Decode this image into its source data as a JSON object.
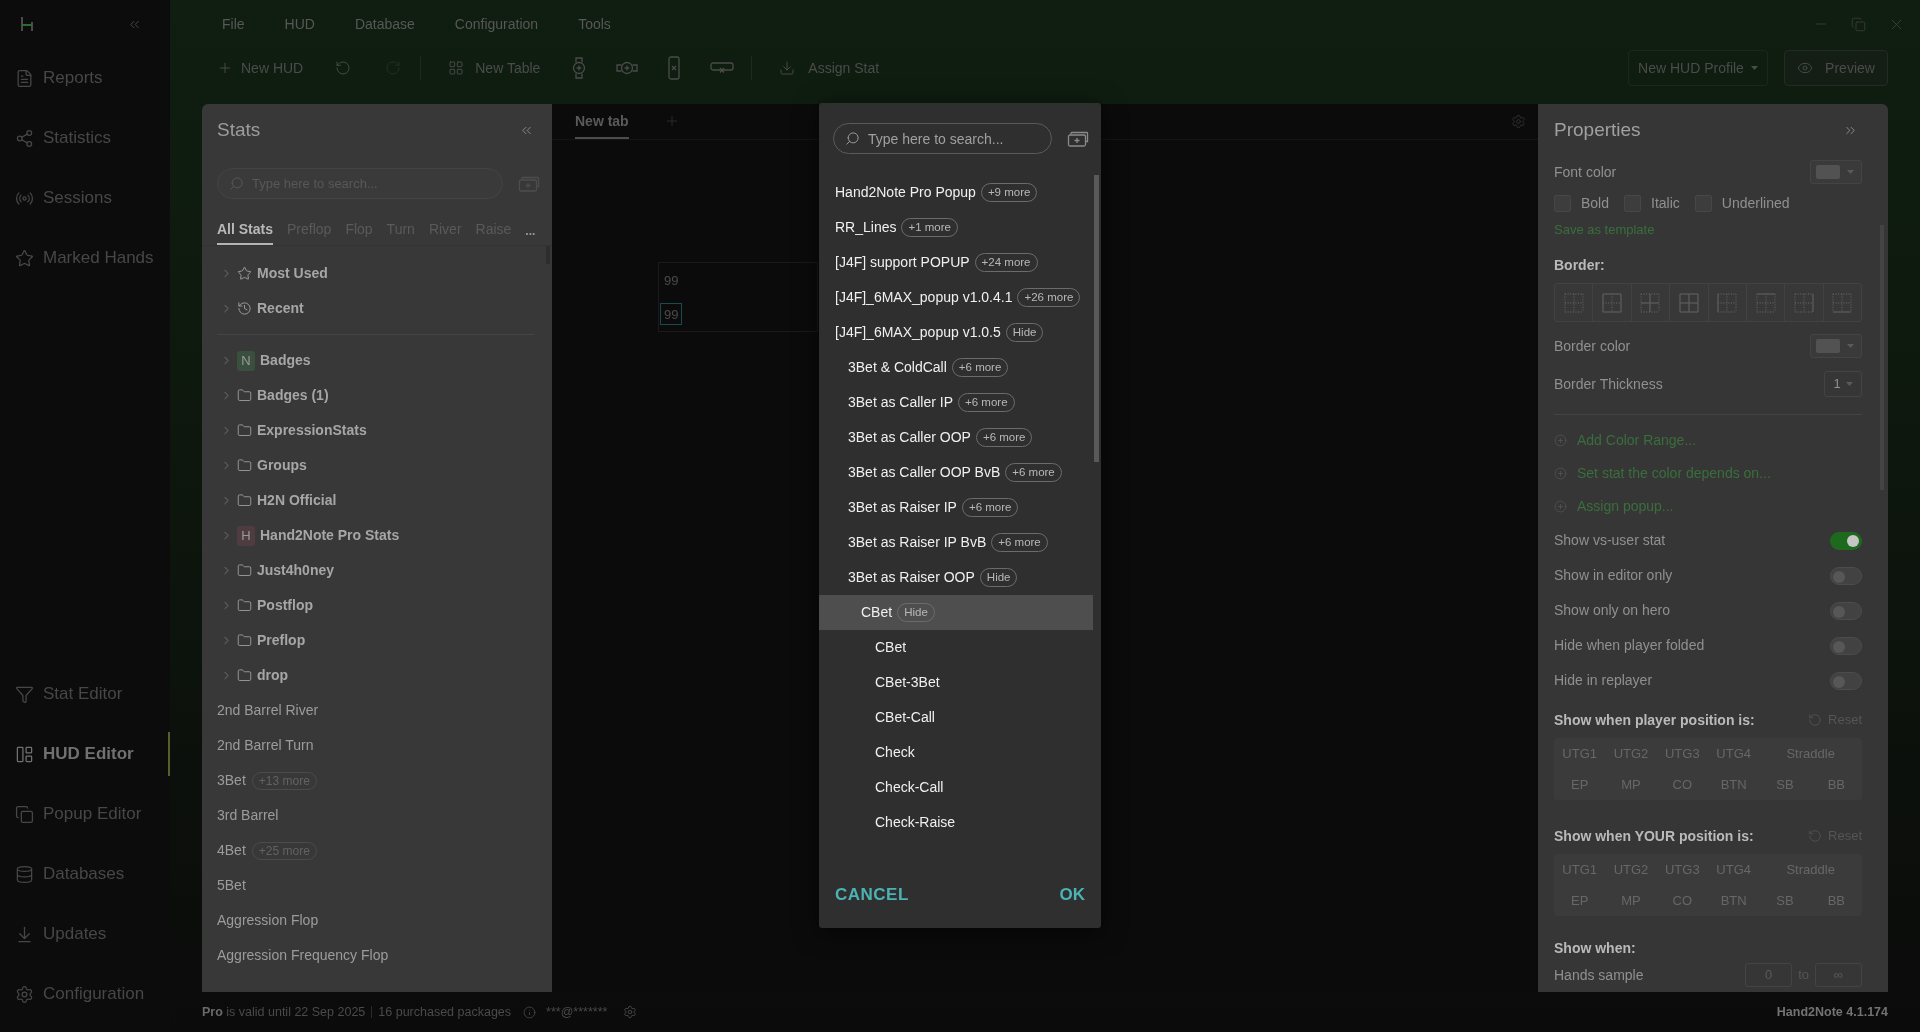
{
  "nav": {
    "top": [
      {
        "label": "Reports",
        "selected": false
      },
      {
        "label": "Statistics",
        "selected": false
      },
      {
        "label": "Sessions",
        "selected": false
      },
      {
        "label": "Marked Hands",
        "selected": false
      }
    ],
    "bottom": [
      {
        "label": "Stat Editor",
        "selected": false
      },
      {
        "label": "HUD Editor",
        "selected": true
      },
      {
        "label": "Popup Editor",
        "selected": false
      },
      {
        "label": "Databases",
        "selected": false
      },
      {
        "label": "Updates",
        "selected": false
      },
      {
        "label": "Configuration",
        "selected": false
      }
    ]
  },
  "menu": [
    "File",
    "HUD",
    "Database",
    "Configuration",
    "Tools"
  ],
  "toolbar": {
    "new_hud": "New HUD",
    "undo": {
      "disabled": false
    },
    "redo": {
      "disabled": true
    },
    "new_table": "New Table",
    "assign_stat": "Assign Stat",
    "profile": "New HUD Profile",
    "preview": "Preview"
  },
  "stats_panel": {
    "title": "Stats",
    "search": {
      "placeholder": "Type here to search..."
    },
    "tabs": [
      {
        "label": "All Stats",
        "selected": true
      },
      {
        "label": "Preflop",
        "selected": false
      },
      {
        "label": "Flop",
        "selected": false
      },
      {
        "label": "Turn",
        "selected": false
      },
      {
        "label": "River",
        "selected": false
      },
      {
        "label": "Raise",
        "selected": false
      }
    ],
    "tabs_more": "...",
    "shortcuts": [
      {
        "label": "Most Used",
        "kind": "starred",
        "expanded": false
      },
      {
        "label": "Recent",
        "kind": "recent",
        "expanded": false
      }
    ],
    "folders": [
      {
        "label": "Badges",
        "kind": "tagged",
        "letter": "N",
        "color": "#3b4f3f",
        "expanded": false
      },
      {
        "label": "Badges (1)",
        "kind": "folder",
        "expanded": false
      },
      {
        "label": "ExpressionStats",
        "kind": "folder",
        "expanded": false
      },
      {
        "label": "Groups",
        "kind": "folder",
        "expanded": false
      },
      {
        "label": "H2N Official",
        "kind": "folder",
        "expanded": false
      },
      {
        "label": "Hand2Note Pro Stats",
        "kind": "tagged",
        "letter": "H",
        "color": "#4f3c40",
        "expanded": false
      },
      {
        "label": "Just4h0ney",
        "kind": "folder",
        "expanded": false
      },
      {
        "label": "Postflop",
        "kind": "folder",
        "expanded": false
      },
      {
        "label": "Preflop",
        "kind": "folder",
        "expanded": false
      },
      {
        "label": "drop",
        "kind": "folder",
        "expanded": false
      }
    ],
    "stats": [
      {
        "label": "2nd Barrel River"
      },
      {
        "label": "2nd Barrel Turn"
      },
      {
        "label": "3Bet",
        "more": "+13 more"
      },
      {
        "label": "3rd Barrel"
      },
      {
        "label": "4Bet",
        "more": "+25 more"
      },
      {
        "label": "5Bet"
      },
      {
        "label": "Aggression Flop"
      },
      {
        "label": "Aggression Frequency Flop"
      }
    ]
  },
  "editor": {
    "tabs": [
      {
        "label": "New tab",
        "selected": true
      }
    ],
    "hud_cells": [
      {
        "text": "99",
        "selected": false
      },
      {
        "text": "99",
        "selected": true
      }
    ]
  },
  "popup_dialog": {
    "search": {
      "placeholder": "Type here to search..."
    },
    "items": [
      {
        "label": "Hand2Note Pro Popup",
        "tag": "+9 more",
        "selected": false
      },
      {
        "label": "RR_Lines",
        "tag": "+1 more",
        "selected": false
      },
      {
        "label": "[J4F] support POPUP",
        "tag": "+24 more",
        "selected": false
      },
      {
        "label": "[J4F]_6MAX_popup v1.0.4.1",
        "tag": "+26 more",
        "selected": false
      },
      {
        "label": "[J4F]_6MAX_popup v1.0.5",
        "tag": "Hide",
        "selected": false,
        "children": [
          {
            "label": "3Bet & ColdCall",
            "tag": "+6 more",
            "selected": false
          },
          {
            "label": "3Bet as Caller IP",
            "tag": "+6 more",
            "selected": false
          },
          {
            "label": "3Bet as Caller OOP",
            "tag": "+6 more",
            "selected": false
          },
          {
            "label": "3Bet as Caller OOP BvB",
            "tag": "+6 more",
            "selected": false
          },
          {
            "label": "3Bet as Raiser IP",
            "tag": "+6 more",
            "selected": false
          },
          {
            "label": "3Bet as Raiser IP BvB",
            "tag": "+6 more",
            "selected": false
          },
          {
            "label": "3Bet as Raiser OOP",
            "tag": "Hide",
            "selected": false,
            "children": [
              {
                "label": "CBet",
                "tag": "Hide",
                "selected": true,
                "children": [
                  {
                    "label": "CBet",
                    "selected": false
                  },
                  {
                    "label": "CBet-3Bet",
                    "selected": false
                  },
                  {
                    "label": "CBet-Call",
                    "selected": false
                  },
                  {
                    "label": "Check",
                    "selected": false
                  },
                  {
                    "label": "Check-Call",
                    "selected": false
                  },
                  {
                    "label": "Check-Raise",
                    "selected": false
                  }
                ]
              }
            ]
          }
        ]
      }
    ],
    "cancel": "CANCEL",
    "ok": "OK"
  },
  "properties": {
    "title": "Properties",
    "font_color": "Font color",
    "styles": [
      {
        "label": "Bold",
        "checked": false
      },
      {
        "label": "Italic",
        "checked": false
      },
      {
        "label": "Underlined",
        "checked": false
      }
    ],
    "save_template": "Save as template",
    "border": "Border:",
    "border_color": "Border color",
    "border_thickness": {
      "label": "Border Thickness",
      "value": "1"
    },
    "actions": [
      "Add Color Range...",
      "Set stat the color depends on...",
      "Assign popup..."
    ],
    "toggles": [
      {
        "label": "Show vs-user stat",
        "on": true
      },
      {
        "label": "Show in editor only",
        "on": false
      },
      {
        "label": "Show only on hero",
        "on": false
      },
      {
        "label": "Hide when player folded",
        "on": false
      },
      {
        "label": "Hide in replayer",
        "on": false
      }
    ],
    "position_filters": [
      {
        "label": "Show when player position is:",
        "reset": "Reset",
        "rows": [
          [
            {
              "label": "UTG1",
              "selected": false
            },
            {
              "label": "UTG2",
              "selected": false
            },
            {
              "label": "UTG3",
              "selected": false
            },
            {
              "label": "UTG4",
              "selected": false
            },
            {
              "label": "Straddle",
              "selected": false
            }
          ],
          [
            {
              "label": "EP",
              "selected": false
            },
            {
              "label": "MP",
              "selected": false
            },
            {
              "label": "CO",
              "selected": false
            },
            {
              "label": "BTN",
              "selected": false
            },
            {
              "label": "SB",
              "selected": false
            },
            {
              "label": "BB",
              "selected": false
            }
          ]
        ]
      },
      {
        "label": "Show when YOUR position is:",
        "reset": "Reset",
        "rows": [
          [
            {
              "label": "UTG1",
              "selected": false
            },
            {
              "label": "UTG2",
              "selected": false
            },
            {
              "label": "UTG3",
              "selected": false
            },
            {
              "label": "UTG4",
              "selected": false
            },
            {
              "label": "Straddle",
              "selected": false
            }
          ],
          [
            {
              "label": "EP",
              "selected": false
            },
            {
              "label": "MP",
              "selected": false
            },
            {
              "label": "CO",
              "selected": false
            },
            {
              "label": "BTN",
              "selected": false
            },
            {
              "label": "SB",
              "selected": false
            },
            {
              "label": "BB",
              "selected": false
            }
          ]
        ]
      }
    ],
    "show_when": "Show when:",
    "hands_sample": {
      "label": "Hands sample",
      "min": "0",
      "separator": "to",
      "max": "∞"
    }
  },
  "status_bar": {
    "license": "**Pro** is valid until 22 Sep 2025",
    "packages": "16 purchased packages",
    "account": "***@*******",
    "version": "Hand2Note 4.1.174"
  }
}
